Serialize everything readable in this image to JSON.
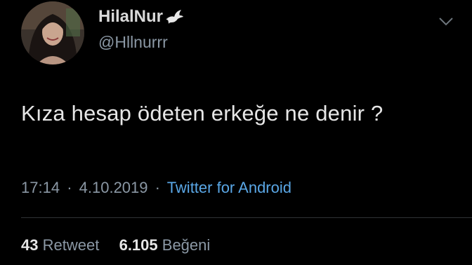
{
  "tweet": {
    "author": {
      "display_name": "HilalNur",
      "handle": "@Hllnurrr",
      "badge_icon": "dove-icon"
    },
    "menu_icon": "chevron-down-icon",
    "text": "Kıza hesap ödeten erkeğe ne denir ?",
    "time": "17:14",
    "date": "4.10.2019",
    "separator": "·",
    "source": "Twitter for Android",
    "stats": {
      "retweets_count": "43",
      "retweets_label": "Retweet",
      "likes_count": "6.105",
      "likes_label": "Beğeni"
    }
  },
  "colors": {
    "background": "#000000",
    "primary_text": "#e6e6e6",
    "secondary_text": "#8b98a5",
    "link": "#5aa7e6",
    "divider": "#2f3336"
  }
}
